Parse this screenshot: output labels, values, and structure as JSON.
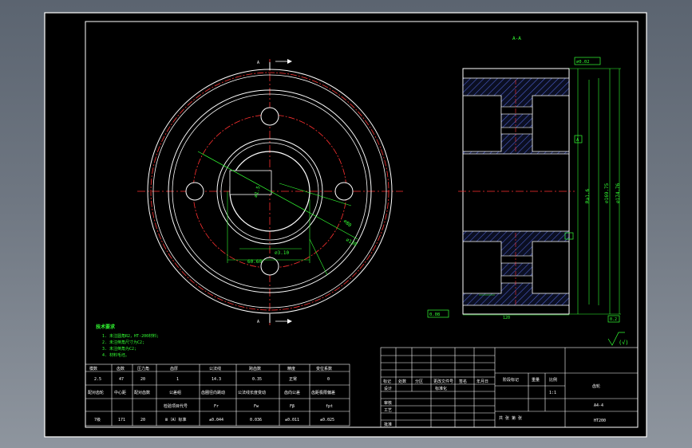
{
  "section": {
    "title": "A-A",
    "flatness_box": "⌀0.02",
    "datum_label": "A",
    "runout_label": "0.08",
    "runout_datum": "A",
    "bottom_box": "0.2",
    "face_dim": "Ra1.6"
  },
  "view": {
    "arrow_top": "A",
    "arrow_bottom": "A",
    "dim_diameter": "⌀130",
    "dim_hole": "⌀80",
    "dim_bolt": "⌀3.10",
    "dim_bore": "⌀1.5",
    "dim_chamfer": "60.60"
  },
  "tech_notes": {
    "title": "技术要求",
    "lines": [
      "1. 未注圆角R2，HT-200材料;",
      "2. 未注倒角尺寸为C2;",
      "3. 未注倒角为C2;",
      "4. 材料毛坯。"
    ]
  },
  "param_table": {
    "headers": [
      "模数",
      "齿数",
      "压力角",
      "齿厚",
      "公法线",
      "跨齿数",
      "精度",
      "变位系数"
    ],
    "row1": [
      "2.5",
      "47",
      "20",
      "1",
      "14.3",
      "0.35",
      "正常",
      "0"
    ],
    "labels": [
      "配对齿轮",
      "中心距",
      "配对齿数",
      "公差组",
      "齿圈径向跳动",
      "公法线长度变动",
      "齿向公差",
      "齿距极限偏差"
    ],
    "row3": [
      "",
      "",
      "",
      "检验项目代号",
      "Fr",
      "Fw",
      "Fβ",
      "fpt"
    ],
    "row4": [
      "7级",
      "171",
      "20",
      "Ⅲ（A）标准",
      "±0.044",
      "0.036",
      "±0.011",
      "±0.025"
    ]
  },
  "title_block": {
    "company": "",
    "drawing_name": "齿轮",
    "drawing_number": "A4-4",
    "scale": "1:1",
    "sheet": "1",
    "material": "HT200",
    "labels": [
      "标记",
      "处数",
      "分区",
      "更改文件号",
      "签名",
      "年月日",
      "设计",
      "审核",
      "工艺",
      "批准",
      "标准化"
    ],
    "stage_label": "阶段标记",
    "weight_label": "重量",
    "scale_label": "比例",
    "sheet_label": "共 张 第 张"
  },
  "colors": {
    "frame": "#ffffff",
    "center": "#ff3030",
    "dim": "#33ff33",
    "hatch": "#3a4aa8"
  }
}
